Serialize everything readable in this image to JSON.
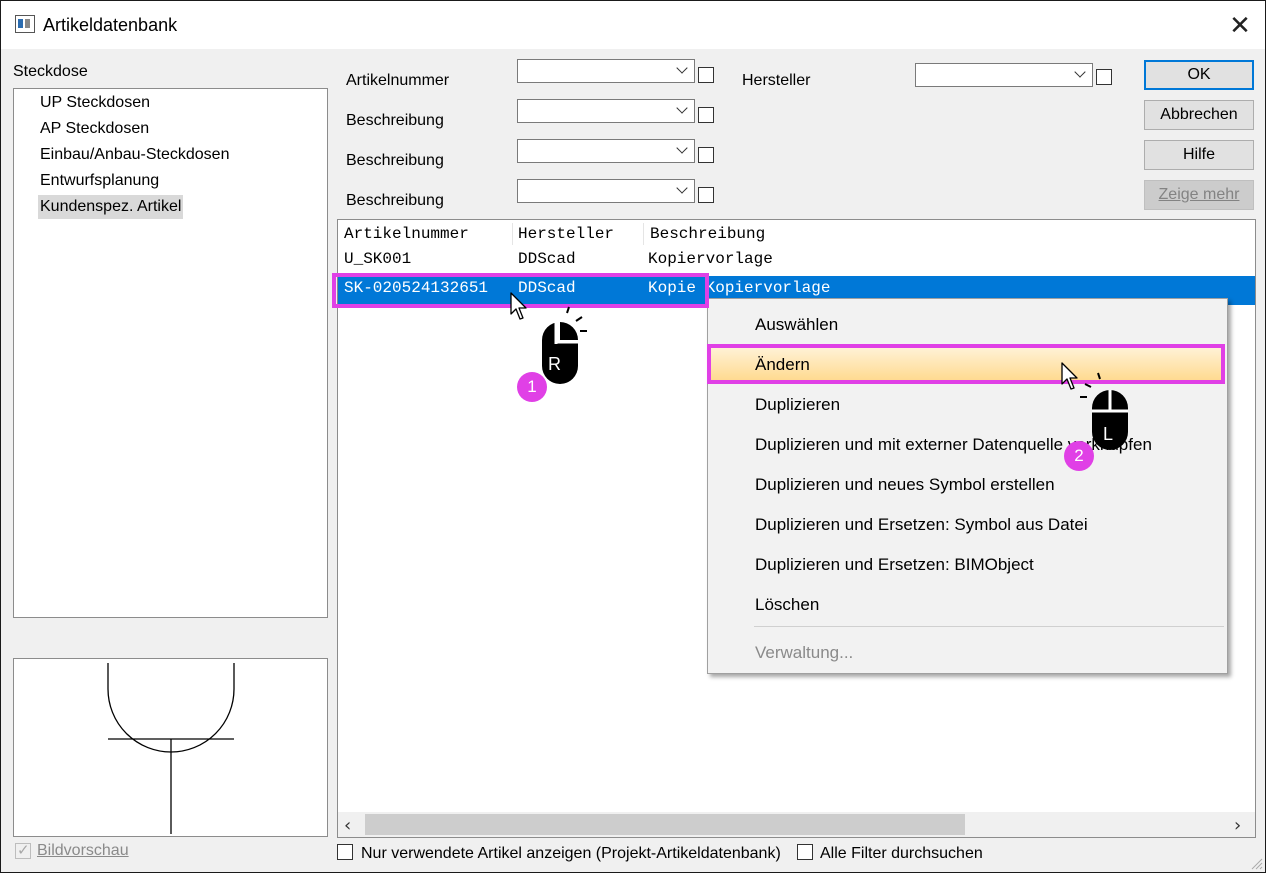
{
  "window": {
    "title": "Artikeldatenbank",
    "close_glyph": "✕"
  },
  "left_panel": {
    "category_label": "Steckdose",
    "tree_items": [
      {
        "label": "UP Steckdosen"
      },
      {
        "label": "AP Steckdosen"
      },
      {
        "label": "Einbau/Anbau-Steckdosen"
      },
      {
        "label": "Entwurfsplanung"
      },
      {
        "label": "Kundenspez. Artikel",
        "selected": true
      }
    ],
    "preview_checkbox_label": "Bildvorschau"
  },
  "filters": {
    "rows": [
      {
        "label": "Artikelnummer",
        "value": ""
      },
      {
        "label": "Beschreibung",
        "value": ""
      },
      {
        "label": "Beschreibung",
        "value": ""
      },
      {
        "label": "Beschreibung",
        "value": ""
      }
    ],
    "manufacturer": {
      "label": "Hersteller",
      "value": ""
    }
  },
  "buttons": {
    "ok": "OK",
    "cancel": "Abbrechen",
    "help": "Hilfe",
    "more": "Zeige mehr"
  },
  "table": {
    "columns": [
      "Artikelnummer",
      "Hersteller",
      "Beschreibung"
    ],
    "rows": [
      {
        "artikelnummer": "U_SK001",
        "hersteller": "DDScad",
        "beschreibung": "Kopiervorlage"
      },
      {
        "artikelnummer": "SK-020524132651",
        "hersteller": "DDScad",
        "beschreibung": "Kopie Kopiervorlage",
        "selected": true
      }
    ]
  },
  "context_menu": {
    "items": [
      {
        "label": "Auswählen"
      },
      {
        "label": "Ändern",
        "highlighted": true
      },
      {
        "label": "Duplizieren"
      },
      {
        "label": "Duplizieren und mit externer Datenquelle verknüpfen"
      },
      {
        "label": "Duplizieren und neues Symbol erstellen"
      },
      {
        "label": "Duplizieren und Ersetzen: Symbol aus Datei"
      },
      {
        "label": "Duplizieren und Ersetzen: BIMObject"
      },
      {
        "label": "Löschen"
      },
      {
        "label": "Verwaltung...",
        "disabled": true
      }
    ]
  },
  "bottom": {
    "only_used_label": "Nur verwendete Artikel anzeigen (Projekt-Artikeldatenbank)",
    "all_filters_label": "Alle Filter durchsuchen"
  },
  "annotations": {
    "step1": {
      "badge": "1",
      "mouse_button": "R"
    },
    "step2": {
      "badge": "2",
      "mouse_button": "L"
    },
    "highlight_color": "#e040e6"
  },
  "colors": {
    "selection": "#0078d7",
    "default_button_border": "#0078d7"
  }
}
